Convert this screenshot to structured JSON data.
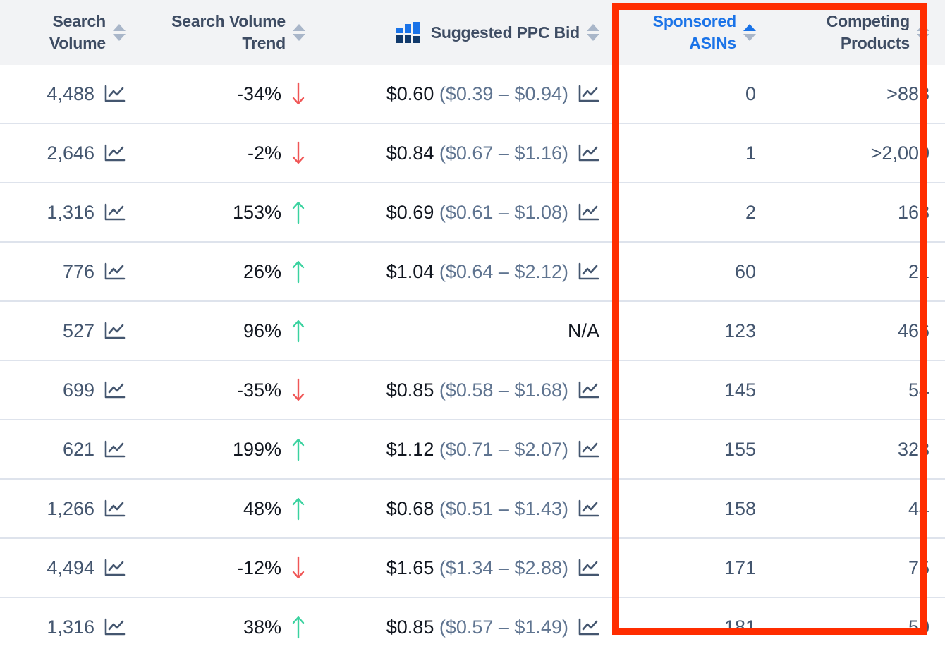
{
  "table": {
    "columns": [
      {
        "id": "search_volume",
        "label": "Search\nVolume",
        "sort": "none",
        "active": false,
        "icon": null
      },
      {
        "id": "search_volume_trend",
        "label": "Search Volume\nTrend",
        "sort": "none",
        "active": false,
        "icon": null
      },
      {
        "id": "suggested_ppc_bid",
        "label": "Suggested PPC Bid",
        "sort": "none",
        "active": false,
        "icon": "bar-chart-icon"
      },
      {
        "id": "sponsored_asins",
        "label": "Sponsored\nASINs",
        "sort": "asc",
        "active": true,
        "icon": null
      },
      {
        "id": "competing_products",
        "label": "Competing\nProducts",
        "sort": "none",
        "active": false,
        "icon": null
      }
    ],
    "rows": [
      {
        "search_volume": "4,488",
        "trend": "-34%",
        "trend_dir": "down",
        "bid": "$0.60",
        "bid_range": "($0.39 – $0.94)",
        "bid_na": false,
        "sponsored_asins": "0",
        "competing_products": ">888"
      },
      {
        "search_volume": "2,646",
        "trend": "-2%",
        "trend_dir": "down",
        "bid": "$0.84",
        "bid_range": "($0.67 – $1.16)",
        "bid_na": false,
        "sponsored_asins": "1",
        "competing_products": ">2,000"
      },
      {
        "search_volume": "1,316",
        "trend": "153%",
        "trend_dir": "up",
        "bid": "$0.69",
        "bid_range": "($0.61 – $1.08)",
        "bid_na": false,
        "sponsored_asins": "2",
        "competing_products": "168"
      },
      {
        "search_volume": "776",
        "trend": "26%",
        "trend_dir": "up",
        "bid": "$1.04",
        "bid_range": "($0.64 – $2.12)",
        "bid_na": false,
        "sponsored_asins": "60",
        "competing_products": "21"
      },
      {
        "search_volume": "527",
        "trend": "96%",
        "trend_dir": "up",
        "bid": "N/A",
        "bid_range": "",
        "bid_na": true,
        "sponsored_asins": "123",
        "competing_products": "466"
      },
      {
        "search_volume": "699",
        "trend": "-35%",
        "trend_dir": "down",
        "bid": "$0.85",
        "bid_range": "($0.58 – $1.68)",
        "bid_na": false,
        "sponsored_asins": "145",
        "competing_products": "54"
      },
      {
        "search_volume": "621",
        "trend": "199%",
        "trend_dir": "up",
        "bid": "$1.12",
        "bid_range": "($0.71 – $2.07)",
        "bid_na": false,
        "sponsored_asins": "155",
        "competing_products": "323"
      },
      {
        "search_volume": "1,266",
        "trend": "48%",
        "trend_dir": "up",
        "bid": "$0.68",
        "bid_range": "($0.51 – $1.43)",
        "bid_na": false,
        "sponsored_asins": "158",
        "competing_products": "44"
      },
      {
        "search_volume": "4,494",
        "trend": "-12%",
        "trend_dir": "down",
        "bid": "$1.65",
        "bid_range": "($1.34 – $2.88)",
        "bid_na": false,
        "sponsored_asins": "171",
        "competing_products": "75"
      },
      {
        "search_volume": "1,316",
        "trend": "38%",
        "trend_dir": "up",
        "bid": "$0.85",
        "bid_range": "($0.57 – $1.49)",
        "bid_na": false,
        "sponsored_asins": "181",
        "competing_products": "50"
      }
    ]
  },
  "icons": {
    "sparkline": "sparkline-chart-icon",
    "trend_up": "trend-up-arrow-icon",
    "trend_down": "trend-down-arrow-icon",
    "bar_chart": "bar-chart-icon",
    "sort": "sort-arrows-icon"
  },
  "annotation": {
    "type": "highlight-rectangle",
    "color": "#ff2d00",
    "covers_columns": [
      "Sponsored ASINs",
      "Competing Products"
    ]
  },
  "colors": {
    "header_bg": "#f2f3f5",
    "header_text": "#3e4c63",
    "active_sort": "#1a73e8",
    "row_divider": "#dee3ec",
    "value_text": "#44566f",
    "bid_primary": "#11161f",
    "bid_range": "#5f7490",
    "trend_up": "#3ad29f",
    "trend_down": "#f05656",
    "sort_inactive": "#a9b6c9",
    "highlight": "#ff2d00"
  }
}
